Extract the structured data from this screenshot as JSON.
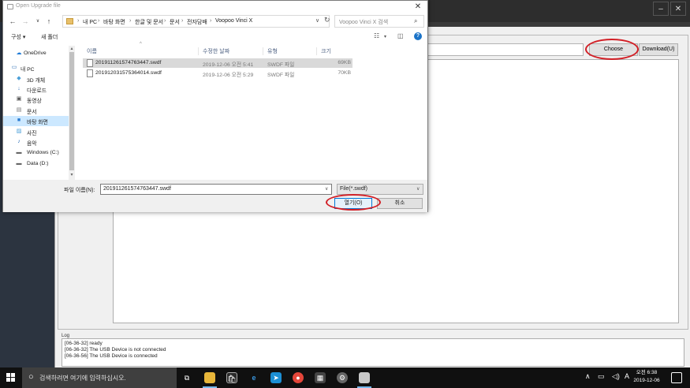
{
  "background_app": {
    "choose_label": "Choose",
    "download_label": "Download(U)",
    "log_title": "Log",
    "log_lines": [
      "[06-36-32] ready",
      "[06-36-32] The USB Device is not connected",
      "[06-36-56] The USB Device is connected"
    ]
  },
  "dialog": {
    "title": "Open Upgrade file",
    "close": "✕",
    "breadcrumbs": [
      "내 PC",
      "바탕 화면",
      "한글 및 문서",
      "문서",
      "전자담배",
      "Voopoo Vinci X"
    ],
    "search_placeholder": "Voopoo Vinci X 검색",
    "toolbar": {
      "organize": "구성",
      "new_folder": "새 폴더"
    },
    "nav_items": [
      {
        "label": "OneDrive",
        "icon": "onedrive-icon"
      },
      {
        "label": "내 PC",
        "icon": "pc-icon"
      },
      {
        "label": "3D 개체",
        "icon": "3d-objects-icon"
      },
      {
        "label": "다운로드",
        "icon": "downloads-icon"
      },
      {
        "label": "동영상",
        "icon": "videos-icon"
      },
      {
        "label": "문서",
        "icon": "documents-icon"
      },
      {
        "label": "바탕 화면",
        "icon": "desktop-icon"
      },
      {
        "label": "사진",
        "icon": "pictures-icon"
      },
      {
        "label": "음악",
        "icon": "music-icon"
      },
      {
        "label": "Windows (C:)",
        "icon": "drive-icon"
      },
      {
        "label": "Data (D:)",
        "icon": "drive-icon"
      }
    ],
    "columns": [
      "이름",
      "수정한 날짜",
      "유형",
      "크기"
    ],
    "files": [
      {
        "name": "201911261574763447.swdf",
        "date": "2019-12-06 오전 5:41",
        "type": "SWDF 파일",
        "size": "69KB"
      },
      {
        "name": "201912031575364014.swdf",
        "date": "2019-12-06 오전 5:29",
        "type": "SWDF 파일",
        "size": "70KB"
      }
    ],
    "filename_label": "파일 이름(N):",
    "filename_value": "201911261574763447.swdf",
    "filter_value": "File(*.swdf)",
    "open_label": "열기(O)",
    "cancel_label": "취소"
  },
  "taskbar": {
    "search_text": "검색하려면 여기에 입력하십시오.",
    "ime": "A",
    "time": "오전 6:38",
    "date": "2019-12-06"
  }
}
